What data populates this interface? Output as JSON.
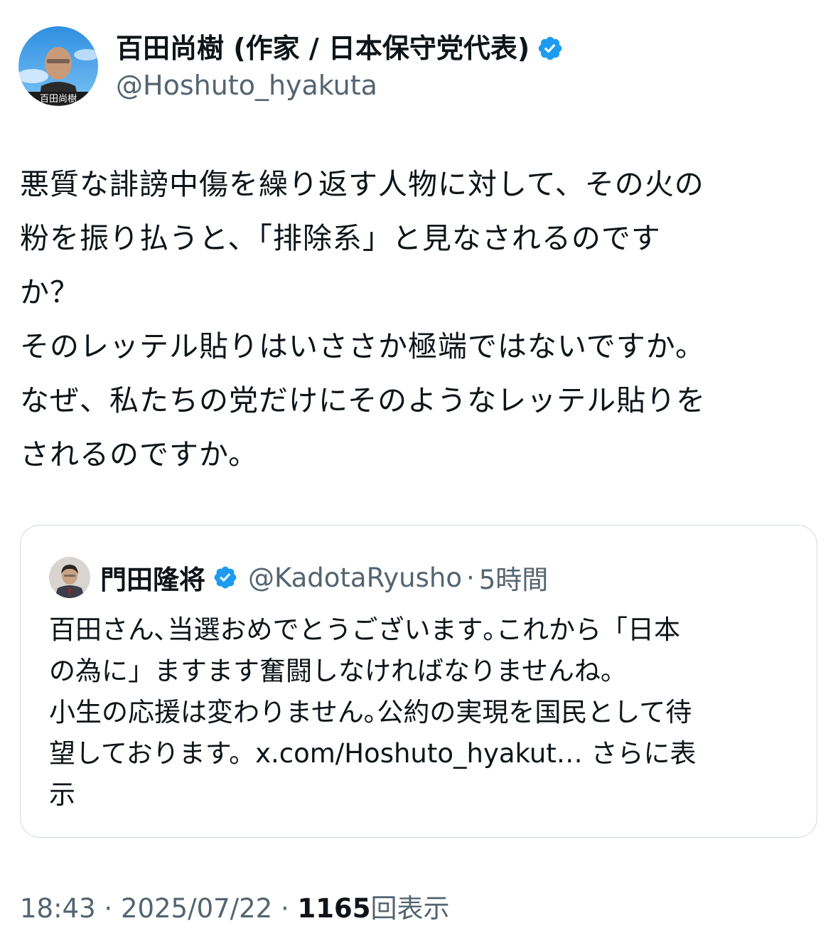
{
  "author": {
    "display_name": "百田尚樹 (作家 / 日本保守党代表)",
    "handle": "@Hoshuto_hyakuta",
    "avatar_caption": "百田尚樹"
  },
  "tweet": {
    "lines": [
      "悪質な誹謗中傷を繰り返す人物に対して、その火の",
      "粉を振り払うと、「排除系」と見なされるのです",
      "か？",
      "そのレッテル貼りはいささか極端ではないですか。",
      "なぜ、私たちの党だけにそのようなレッテル貼りを",
      "されるのですか。"
    ]
  },
  "quote": {
    "display_name": "門田隆将",
    "handle": "@KadotaRyusho",
    "separator": "·",
    "time": "5時間",
    "lines": [
      "百田さん､当選おめでとうございます｡これから「日本",
      "の為に」ますます奮闘しなければなりませんね。",
      "小生の応援は変わりません｡公約の実現を国民として待"
    ],
    "last_line_prefix": "望しております。",
    "link": "x.com/Hoshuto_hyakut…",
    "show_more_a": " さらに表",
    "show_more_b": "示"
  },
  "footer": {
    "time": "18:43",
    "sep1": " · ",
    "date": "2025/07/22",
    "sep2": " · ",
    "views": "1165",
    "views_label": "回表示"
  },
  "colors": {
    "verified": "#1d9bf0",
    "secondary_text": "#536471",
    "border": "#cfd9de"
  },
  "icons": {
    "verified": "verified-badge-icon"
  }
}
